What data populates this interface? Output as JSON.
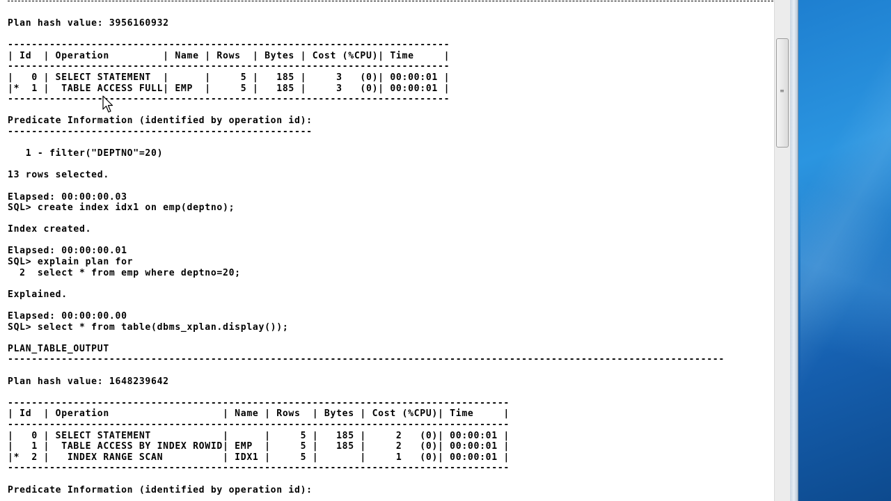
{
  "console": {
    "lines": [
      "Plan hash value: 3956160932",
      "",
      "--------------------------------------------------------------------------",
      "| Id  | Operation         | Name | Rows  | Bytes | Cost (%CPU)| Time     |",
      "--------------------------------------------------------------------------",
      "|   0 | SELECT STATEMENT  |      |     5 |   185 |     3   (0)| 00:00:01 |",
      "|*  1 |  TABLE ACCESS FULL| EMP  |     5 |   185 |     3   (0)| 00:00:01 |",
      "--------------------------------------------------------------------------",
      "",
      "Predicate Information (identified by operation id):",
      "---------------------------------------------------",
      "",
      "   1 - filter(\"DEPTNO\"=20)",
      "",
      "13 rows selected.",
      "",
      "Elapsed: 00:00:00.03",
      "SQL> create index idx1 on emp(deptno);",
      "",
      "Index created.",
      "",
      "Elapsed: 00:00:00.01",
      "SQL> explain plan for",
      "  2  select * from emp where deptno=20;",
      "",
      "Explained.",
      "",
      "Elapsed: 00:00:00.00",
      "SQL> select * from table(dbms_xplan.display());",
      "",
      "PLAN_TABLE_OUTPUT",
      "------------------------------------------------------------------------------------------------------------------------",
      "",
      "Plan hash value: 1648239642",
      "",
      "------------------------------------------------------------------------------------",
      "| Id  | Operation                   | Name | Rows  | Bytes | Cost (%CPU)| Time     |",
      "------------------------------------------------------------------------------------",
      "|   0 | SELECT STATEMENT            |      |     5 |   185 |     2   (0)| 00:00:01 |",
      "|   1 |  TABLE ACCESS BY INDEX ROWID| EMP  |     5 |   185 |     2   (0)| 00:00:01 |",
      "|*  2 |   INDEX RANGE SCAN          | IDX1 |     5 |       |     1   (0)| 00:00:01 |",
      "------------------------------------------------------------------------------------",
      "",
      "Predicate Information (identified by operation id):"
    ]
  },
  "icons": {
    "cursor": "mouse-pointer-icon",
    "grip": "scroll-grip-icon"
  },
  "colors": {
    "console_bg": "#ffffff",
    "console_text": "#000000",
    "desktop": "#1e7fd0"
  }
}
